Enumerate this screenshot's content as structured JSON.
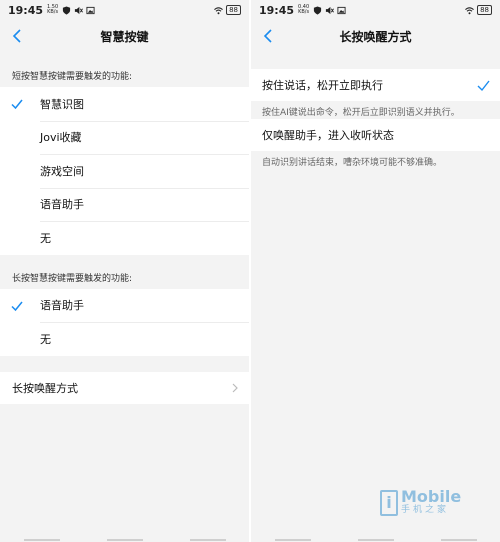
{
  "accent_color": "#1a8cf0",
  "left": {
    "status": {
      "time": "19:45",
      "speed_value": "1.50",
      "speed_unit": "KB/s",
      "battery": "88"
    },
    "title": "智慧按键",
    "short_press_label": "短按智慧按键需要触发的功能:",
    "short_press_items": [
      {
        "label": "智慧识图",
        "checked": true
      },
      {
        "label": "Jovi收藏",
        "checked": false
      },
      {
        "label": "游戏空间",
        "checked": false
      },
      {
        "label": "语音助手",
        "checked": false
      },
      {
        "label": "无",
        "checked": false
      }
    ],
    "long_press_label": "长按智慧按键需要触发的功能:",
    "long_press_items": [
      {
        "label": "语音助手",
        "checked": true
      },
      {
        "label": "无",
        "checked": false
      }
    ],
    "wake_mode_label": "长按唤醒方式"
  },
  "right": {
    "status": {
      "time": "19:45",
      "speed_value": "0.40",
      "speed_unit": "KB/s",
      "battery": "88"
    },
    "title": "长按唤醒方式",
    "options": [
      {
        "label": "按住说话，松开立即执行",
        "desc": "按住AI键说出命令，松开后立即识别语义并执行。",
        "checked": true
      },
      {
        "label": "仅唤醒助手，进入收听状态",
        "desc": "自动识别讲话结束，嘈杂环境可能不够准确。",
        "checked": false
      }
    ]
  },
  "watermark": {
    "main": "Mobile",
    "sub": "手机之家",
    "letter": "i"
  }
}
